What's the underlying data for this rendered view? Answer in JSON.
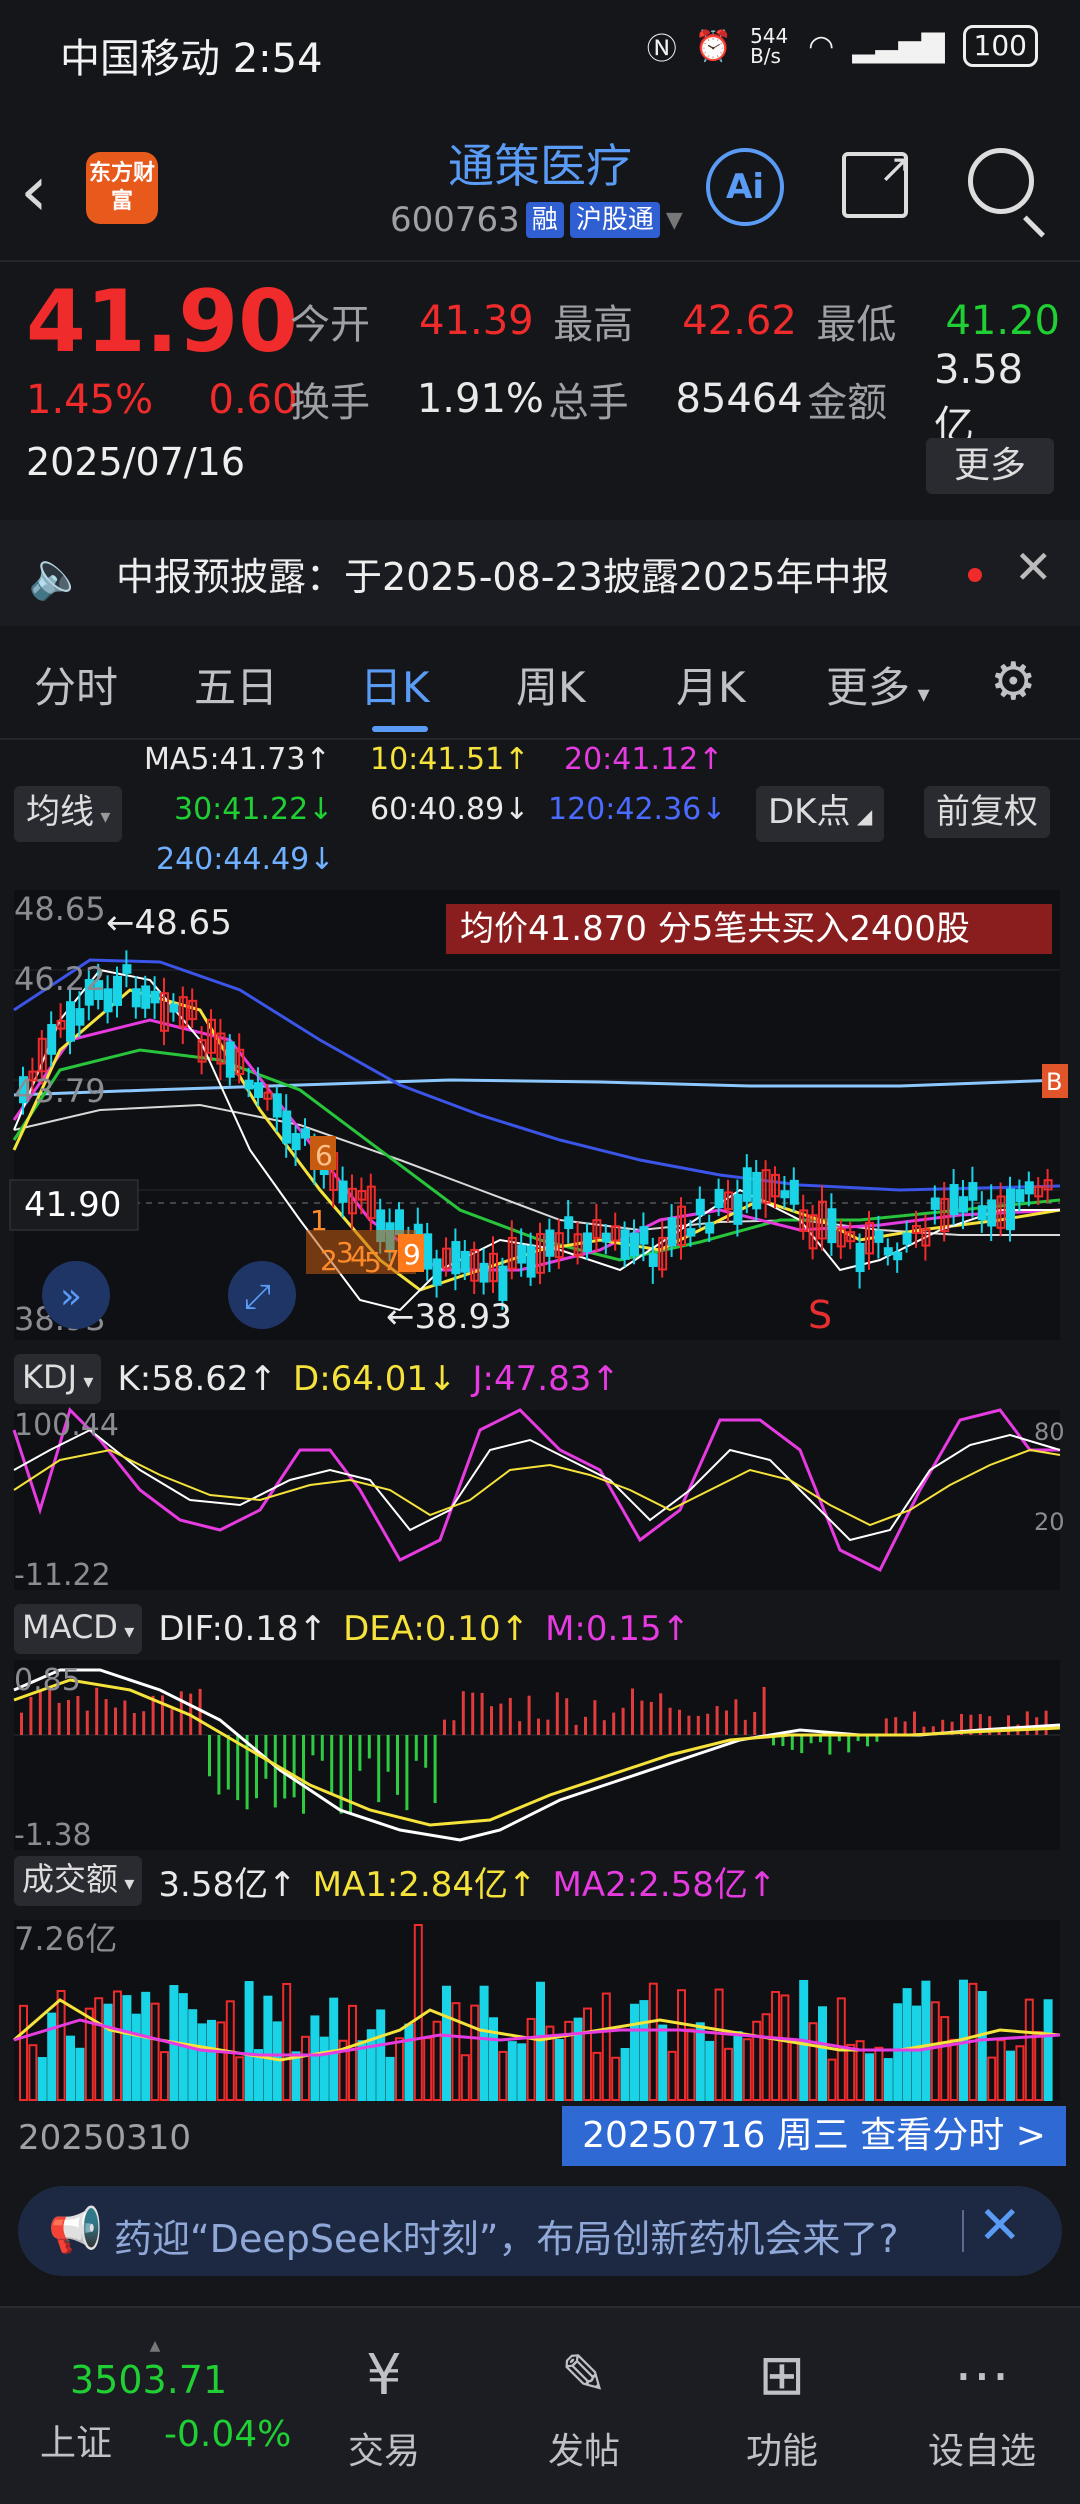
{
  "status_bar": {
    "carrier_time": "中国移动 2:54",
    "net_speed": "544 B/s",
    "battery": "100"
  },
  "header": {
    "logo_text": "东方财富",
    "stock_name": "通策医疗",
    "stock_code": "600763",
    "tag_margin": "融",
    "tag_connect": "沪股通"
  },
  "quote": {
    "price": "41.90",
    "change_pct": "1.45%",
    "change_amt": "0.60",
    "date": "2025/07/16",
    "fields": [
      {
        "label": "今开",
        "value": "41.39",
        "color": "red"
      },
      {
        "label": "最高",
        "value": "42.62",
        "color": "red"
      },
      {
        "label": "最低",
        "value": "41.20",
        "color": "green"
      },
      {
        "label": "换手",
        "value": "1.91%",
        "color": "white"
      },
      {
        "label": "总手",
        "value": "85464",
        "color": "white"
      },
      {
        "label": "金额",
        "value": "3.58亿",
        "color": "white"
      }
    ],
    "more": "更多"
  },
  "notice": {
    "text": "中报预披露：于2025-08-23披露2025年中报"
  },
  "tabs": [
    "分时",
    "五日",
    "日K",
    "周K",
    "月K",
    "更多"
  ],
  "active_tab": "日K",
  "ma_row": {
    "ma5": "MA5:41.73↑",
    "ma10": "10:41.51↑",
    "ma20": "20:41.12↑",
    "ma30": "30:41.22↓",
    "ma60": "60:40.89↓",
    "ma120": "120:42.36↓",
    "ma240": "240:44.49↓",
    "line_button": "均线",
    "dk_button": "DK点",
    "adjust_button": "前复权"
  },
  "kline": {
    "y_high": "48.65",
    "y_mid1": "46.22",
    "y_mid2": "43.79",
    "y_low": "38.93",
    "high_mark": "←48.65",
    "low_mark": "←38.93",
    "current": "41.90",
    "avg_banner": "均价41.870  分5笔共买入2400股",
    "nums": [
      "1",
      "2",
      "3",
      "4",
      "5",
      "6",
      "7",
      "9"
    ],
    "sell_mark": "S",
    "right_tag": "B"
  },
  "kdj": {
    "button": "KDJ",
    "k": "K:58.62↑",
    "d": "D:64.01↓",
    "j": "J:47.83↑",
    "top": "100.44",
    "bottom": "-11.22",
    "r80": "80",
    "r20": "20"
  },
  "macd": {
    "button": "MACD",
    "dif": "DIF:0.18↑",
    "dea": "DEA:0.10↑",
    "m": "M:0.15↑",
    "top": "0.85",
    "bottom": "-1.38"
  },
  "volume": {
    "button": "成交额",
    "value": "3.58亿↑",
    "ma1": "MA1:2.84亿↑",
    "ma2": "MA2:2.58亿↑",
    "top": "7.26亿"
  },
  "footer_chart": {
    "start_date": "20250310",
    "view_button": "20250716 周三 查看分时 >"
  },
  "banner": {
    "text": "药迎“DeepSeek时刻”，布局创新药机会来了?"
  },
  "bottom_nav": {
    "index_value": "3503.71",
    "index_name": "上证",
    "index_change": "-0.04%",
    "items": [
      "交易",
      "发帖",
      "功能",
      "设自选"
    ]
  }
}
